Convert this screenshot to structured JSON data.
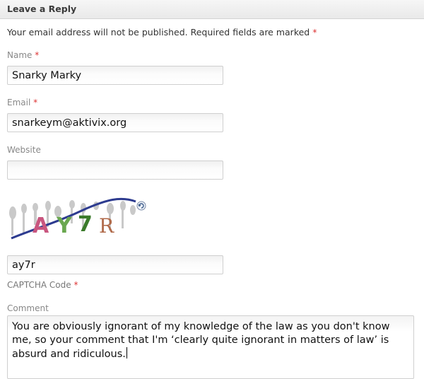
{
  "header": {
    "title": "Leave a Reply"
  },
  "notice": {
    "text": "Your email address will not be published. Required fields are marked",
    "required_mark": "*"
  },
  "fields": {
    "name": {
      "label": "Name",
      "required_mark": "*",
      "value": "Snarky Marky"
    },
    "email": {
      "label": "Email",
      "required_mark": "*",
      "value": "snarkeym@aktivix.org"
    },
    "website": {
      "label": "Website",
      "value": ""
    },
    "captcha": {
      "image_text": "AY7R",
      "value": "ay7r",
      "label": "CAPTCHA Code",
      "required_mark": "*"
    },
    "comment": {
      "label": "Comment",
      "value": "You are obviously ignorant of my knowledge of the law as you don't know me, so your comment that I'm ‘clearly quite ignorant in matters of law’ is absurd and ridiculous."
    }
  },
  "icons": {
    "captcha_refresh": "refresh-icon"
  },
  "colors": {
    "required": "#dd3333",
    "label": "#888888",
    "header_bg": "#eeeeee"
  }
}
